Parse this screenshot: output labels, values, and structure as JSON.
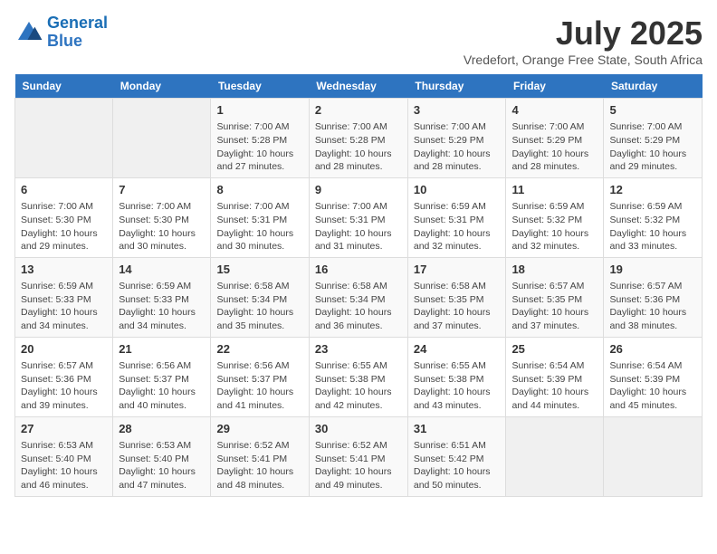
{
  "logo": {
    "line1": "General",
    "line2": "Blue"
  },
  "title": "July 2025",
  "location": "Vredefort, Orange Free State, South Africa",
  "days_of_week": [
    "Sunday",
    "Monday",
    "Tuesday",
    "Wednesday",
    "Thursday",
    "Friday",
    "Saturday"
  ],
  "weeks": [
    [
      {
        "day": "",
        "content": ""
      },
      {
        "day": "",
        "content": ""
      },
      {
        "day": "1",
        "content": "Sunrise: 7:00 AM\nSunset: 5:28 PM\nDaylight: 10 hours\nand 27 minutes."
      },
      {
        "day": "2",
        "content": "Sunrise: 7:00 AM\nSunset: 5:28 PM\nDaylight: 10 hours\nand 28 minutes."
      },
      {
        "day": "3",
        "content": "Sunrise: 7:00 AM\nSunset: 5:29 PM\nDaylight: 10 hours\nand 28 minutes."
      },
      {
        "day": "4",
        "content": "Sunrise: 7:00 AM\nSunset: 5:29 PM\nDaylight: 10 hours\nand 28 minutes."
      },
      {
        "day": "5",
        "content": "Sunrise: 7:00 AM\nSunset: 5:29 PM\nDaylight: 10 hours\nand 29 minutes."
      }
    ],
    [
      {
        "day": "6",
        "content": "Sunrise: 7:00 AM\nSunset: 5:30 PM\nDaylight: 10 hours\nand 29 minutes."
      },
      {
        "day": "7",
        "content": "Sunrise: 7:00 AM\nSunset: 5:30 PM\nDaylight: 10 hours\nand 30 minutes."
      },
      {
        "day": "8",
        "content": "Sunrise: 7:00 AM\nSunset: 5:31 PM\nDaylight: 10 hours\nand 30 minutes."
      },
      {
        "day": "9",
        "content": "Sunrise: 7:00 AM\nSunset: 5:31 PM\nDaylight: 10 hours\nand 31 minutes."
      },
      {
        "day": "10",
        "content": "Sunrise: 6:59 AM\nSunset: 5:31 PM\nDaylight: 10 hours\nand 32 minutes."
      },
      {
        "day": "11",
        "content": "Sunrise: 6:59 AM\nSunset: 5:32 PM\nDaylight: 10 hours\nand 32 minutes."
      },
      {
        "day": "12",
        "content": "Sunrise: 6:59 AM\nSunset: 5:32 PM\nDaylight: 10 hours\nand 33 minutes."
      }
    ],
    [
      {
        "day": "13",
        "content": "Sunrise: 6:59 AM\nSunset: 5:33 PM\nDaylight: 10 hours\nand 34 minutes."
      },
      {
        "day": "14",
        "content": "Sunrise: 6:59 AM\nSunset: 5:33 PM\nDaylight: 10 hours\nand 34 minutes."
      },
      {
        "day": "15",
        "content": "Sunrise: 6:58 AM\nSunset: 5:34 PM\nDaylight: 10 hours\nand 35 minutes."
      },
      {
        "day": "16",
        "content": "Sunrise: 6:58 AM\nSunset: 5:34 PM\nDaylight: 10 hours\nand 36 minutes."
      },
      {
        "day": "17",
        "content": "Sunrise: 6:58 AM\nSunset: 5:35 PM\nDaylight: 10 hours\nand 37 minutes."
      },
      {
        "day": "18",
        "content": "Sunrise: 6:57 AM\nSunset: 5:35 PM\nDaylight: 10 hours\nand 37 minutes."
      },
      {
        "day": "19",
        "content": "Sunrise: 6:57 AM\nSunset: 5:36 PM\nDaylight: 10 hours\nand 38 minutes."
      }
    ],
    [
      {
        "day": "20",
        "content": "Sunrise: 6:57 AM\nSunset: 5:36 PM\nDaylight: 10 hours\nand 39 minutes."
      },
      {
        "day": "21",
        "content": "Sunrise: 6:56 AM\nSunset: 5:37 PM\nDaylight: 10 hours\nand 40 minutes."
      },
      {
        "day": "22",
        "content": "Sunrise: 6:56 AM\nSunset: 5:37 PM\nDaylight: 10 hours\nand 41 minutes."
      },
      {
        "day": "23",
        "content": "Sunrise: 6:55 AM\nSunset: 5:38 PM\nDaylight: 10 hours\nand 42 minutes."
      },
      {
        "day": "24",
        "content": "Sunrise: 6:55 AM\nSunset: 5:38 PM\nDaylight: 10 hours\nand 43 minutes."
      },
      {
        "day": "25",
        "content": "Sunrise: 6:54 AM\nSunset: 5:39 PM\nDaylight: 10 hours\nand 44 minutes."
      },
      {
        "day": "26",
        "content": "Sunrise: 6:54 AM\nSunset: 5:39 PM\nDaylight: 10 hours\nand 45 minutes."
      }
    ],
    [
      {
        "day": "27",
        "content": "Sunrise: 6:53 AM\nSunset: 5:40 PM\nDaylight: 10 hours\nand 46 minutes."
      },
      {
        "day": "28",
        "content": "Sunrise: 6:53 AM\nSunset: 5:40 PM\nDaylight: 10 hours\nand 47 minutes."
      },
      {
        "day": "29",
        "content": "Sunrise: 6:52 AM\nSunset: 5:41 PM\nDaylight: 10 hours\nand 48 minutes."
      },
      {
        "day": "30",
        "content": "Sunrise: 6:52 AM\nSunset: 5:41 PM\nDaylight: 10 hours\nand 49 minutes."
      },
      {
        "day": "31",
        "content": "Sunrise: 6:51 AM\nSunset: 5:42 PM\nDaylight: 10 hours\nand 50 minutes."
      },
      {
        "day": "",
        "content": ""
      },
      {
        "day": "",
        "content": ""
      }
    ]
  ]
}
